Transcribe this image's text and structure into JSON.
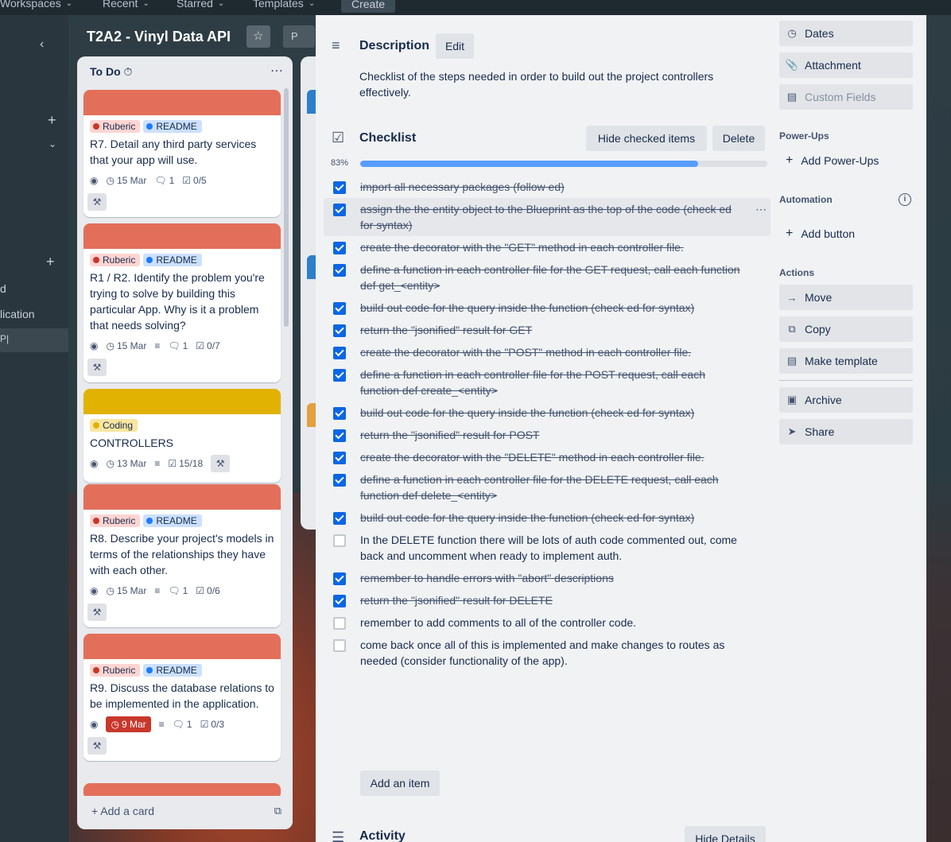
{
  "topbar": {
    "workspaces": "Workspaces",
    "recent": "Recent",
    "starred": "Starred",
    "templates": "Templates",
    "create": "Create"
  },
  "sidebar": {
    "row_d": "d",
    "row_application": "lication",
    "row_p": "P|"
  },
  "board": {
    "title": "T2A2 - Vinyl Data API",
    "view_label": "P"
  },
  "list": {
    "title": "To Do",
    "add_card": "Add a card",
    "cards": [
      {
        "cover_color": "#e36f5a",
        "labels": [
          {
            "text": "Ruberic",
            "style": "red"
          },
          {
            "text": "README",
            "style": "blue"
          }
        ],
        "title": "R7. Detail any third party services that your app will use.",
        "due": "15 Mar",
        "comments": "1",
        "checklist": "0/5"
      },
      {
        "cover_color": "#e36f5a",
        "labels": [
          {
            "text": "Ruberic",
            "style": "red"
          },
          {
            "text": "README",
            "style": "blue"
          }
        ],
        "title": "R1 / R2. Identify the problem you're trying to solve by building this particular App. Why is it a problem that needs solving?",
        "due": "15 Mar",
        "comments": "1",
        "checklist": "0/7"
      },
      {
        "cover_color": "#e2b203",
        "labels": [
          {
            "text": "Coding",
            "style": "yellow"
          }
        ],
        "title": "CONTROLLERS",
        "due": "13 Mar",
        "checklist": "15/18"
      },
      {
        "cover_color": "#e36f5a",
        "labels": [
          {
            "text": "Ruberic",
            "style": "red"
          },
          {
            "text": "README",
            "style": "blue"
          }
        ],
        "title": "R8. Describe your project's models in terms of the relationships they have with each other.",
        "due": "15 Mar",
        "comments": "1",
        "checklist": "0/6"
      },
      {
        "cover_color": "#e36f5a",
        "labels": [
          {
            "text": "Ruberic",
            "style": "red"
          },
          {
            "text": "README",
            "style": "blue"
          }
        ],
        "title": "R9. Discuss the database relations to be implemented in the application.",
        "due": "9 Mar",
        "comments": "1",
        "checklist": "0/3"
      }
    ]
  },
  "modal": {
    "description": {
      "title": "Description",
      "edit": "Edit",
      "text": "Checklist of the steps needed in order to build out the project controllers effectively."
    },
    "checklist": {
      "title": "Checklist",
      "hide_checked": "Hide checked items",
      "delete": "Delete",
      "percent_label": "83%",
      "percent": 83,
      "add_item": "Add an item",
      "items": [
        {
          "text": "import all necessary packages (follow ed)",
          "checked": true
        },
        {
          "text": "assign the the entity object to the Blueprint as the top of the code (check ed for syntax)",
          "checked": true
        },
        {
          "text": "create the decorator with the \"GET\" method in each controller file.",
          "checked": true
        },
        {
          "text": "define a function in each controller file for the GET request, call each function def get_<entity>",
          "checked": true
        },
        {
          "text": "build out code for the query inside the function (check ed for syntax)",
          "checked": true
        },
        {
          "text": "return the \"jsonified\" result for GET",
          "checked": true
        },
        {
          "text": "create the decorator with the \"POST\" method in each controller file.",
          "checked": true
        },
        {
          "text": "define a function in each controller file for the POST request, call each function def create_<entity>",
          "checked": true
        },
        {
          "text": "build out code for the query inside the function (check ed for syntax)",
          "checked": true
        },
        {
          "text": "return the \"jsonified\" result for POST",
          "checked": true
        },
        {
          "text": "create the decorator with the \"DELETE\" method in each controller file.",
          "checked": true
        },
        {
          "text": "define a function in each controller file for the DELETE request, call each function def delete_<entity>",
          "checked": true
        },
        {
          "text": "build out code for the query inside the function (check ed for syntax)",
          "checked": true
        },
        {
          "text": "In the DELETE function there will be lots of auth code commented out, come back and uncomment when ready to implement auth.",
          "checked": false
        },
        {
          "text": "remember to handle errors with \"abort\" descriptions",
          "checked": true
        },
        {
          "text": "return the \"jsonified\" result for DELETE",
          "checked": true
        },
        {
          "text": "remember to add comments to all of the controller code.",
          "checked": false
        },
        {
          "text": "come back once all of this is implemented and make changes to routes as needed (consider functionality of the app).",
          "checked": false
        }
      ]
    },
    "activity": {
      "title": "Activity",
      "hide_details": "Hide Details"
    },
    "side": {
      "dates": "Dates",
      "attachment": "Attachment",
      "custom_fields": "Custom Fields",
      "powerups_heading": "Power-Ups",
      "add_powerups": "Add Power-Ups",
      "automation_heading": "Automation",
      "add_button": "Add button",
      "actions_heading": "Actions",
      "move": "Move",
      "copy": "Copy",
      "make_template": "Make template",
      "archive": "Archive",
      "share": "Share"
    }
  },
  "colors": {
    "accent": "#0c66e4",
    "progress": "#579dff",
    "due_overdue": "#c9372c"
  }
}
